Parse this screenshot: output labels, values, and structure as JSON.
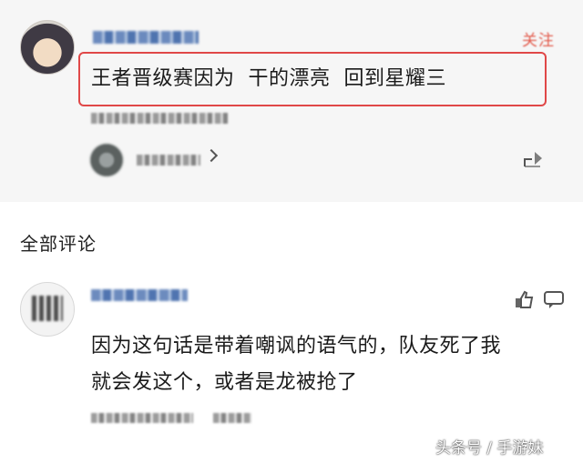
{
  "post": {
    "comment_text": "王者晋级赛因为  干的漂亮  回到星耀三",
    "author_name_obscured": "",
    "follow_label": "关注",
    "reply_count_label": ""
  },
  "comments_section": {
    "title": "全部评论",
    "comment": {
      "line1": "因为这句话是带着嘲讽的语气的，队友死了我",
      "line2": "就会发这个，或者是龙被抢了"
    }
  },
  "watermark": "头条号 / 手游妹",
  "colors": {
    "highlight_border": "#e04848",
    "top_background": "#f6f6f6",
    "follow_red": "#e25a4b"
  },
  "icons": [
    "chevron-right-icon",
    "share-icon",
    "like-icon",
    "reply-icon"
  ]
}
